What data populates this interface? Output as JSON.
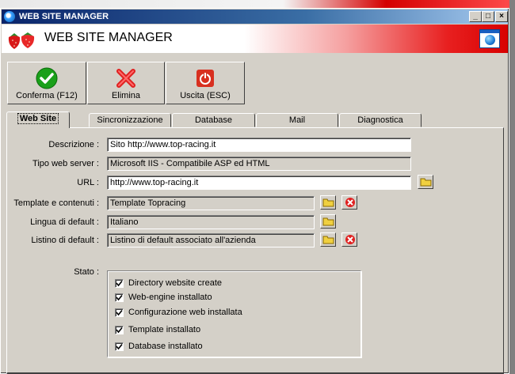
{
  "window": {
    "title": "WEB SITE MANAGER",
    "banner_title": "WEB SITE MANAGER",
    "controls": {
      "minimize": "_",
      "maximize": "□",
      "close": "×"
    },
    "title_icon": "app-globe-icon",
    "banner_logo": "strawberries-logo",
    "banner_icon": "browser-window-icon"
  },
  "toolbar": {
    "confirm": {
      "label": "Conferma (F12)",
      "icon": "check-circle-icon",
      "color": "#1aa01a"
    },
    "delete": {
      "label": "Elimina",
      "icon": "red-x-icon",
      "color": "#e02020"
    },
    "exit": {
      "label": "Uscita (ESC)",
      "icon": "power-icon",
      "color": "#d83020"
    }
  },
  "tabs": [
    {
      "label": "Web Site",
      "active": true
    },
    {
      "label": "Sincronizzazione",
      "active": false
    },
    {
      "label": "Database",
      "active": false
    },
    {
      "label": "Mail",
      "active": false
    },
    {
      "label": "Diagnostica",
      "active": false
    }
  ],
  "form": {
    "descrizione": {
      "label": "Descrizione :",
      "value": "Sito http://www.top-racing.it"
    },
    "tipo_server": {
      "label": "Tipo web server :",
      "value": "Microsoft IIS - Compatibile ASP ed HTML"
    },
    "url": {
      "label": "URL :",
      "value": "http://www.top-racing.it"
    },
    "template": {
      "label": "Template e contenuti :",
      "value": "Template Topracing"
    },
    "lingua": {
      "label": "Lingua di default :",
      "value": "Italiano"
    },
    "listino": {
      "label": "Listino di default :",
      "value": "Listino di default associato all'azienda"
    }
  },
  "stato": {
    "label": "Stato :",
    "items": [
      {
        "label": "Directory website create",
        "checked": true
      },
      {
        "label": "Web-engine installato",
        "checked": true
      },
      {
        "label": "Configurazione web installata",
        "checked": true
      },
      {
        "label": "Template installato",
        "checked": true
      },
      {
        "label": "Database installato",
        "checked": true
      }
    ]
  }
}
